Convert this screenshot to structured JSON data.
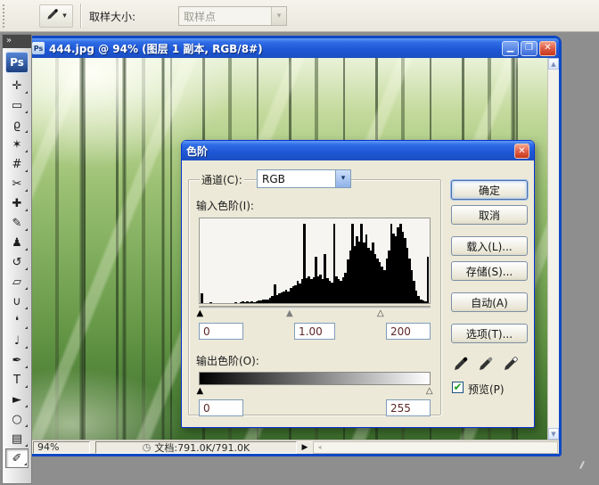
{
  "options_bar": {
    "dropdown_arrow_glyph": "▾",
    "sample_size_label": "取样大小:",
    "sample_point_value": "取样点"
  },
  "toolbox": {
    "collapse_glyph": "»",
    "logo_text": "Ps",
    "tools": [
      {
        "name": "move-tool",
        "glyph": "✛"
      },
      {
        "name": "marquee-tool",
        "glyph": "▭"
      },
      {
        "name": "lasso-tool",
        "glyph": "ϱ"
      },
      {
        "name": "magic-wand-tool",
        "glyph": "✶"
      },
      {
        "name": "crop-tool",
        "glyph": "#"
      },
      {
        "name": "slice-tool",
        "glyph": "✂"
      },
      {
        "name": "healing-brush-tool",
        "glyph": "✚"
      },
      {
        "name": "brush-tool",
        "glyph": "✎"
      },
      {
        "name": "clone-stamp-tool",
        "glyph": "♟"
      },
      {
        "name": "history-brush-tool",
        "glyph": "↺"
      },
      {
        "name": "eraser-tool",
        "glyph": "▱"
      },
      {
        "name": "paint-bucket-tool",
        "glyph": "∪"
      },
      {
        "name": "blur-tool",
        "glyph": "❛"
      },
      {
        "name": "dodge-tool",
        "glyph": "♩"
      },
      {
        "name": "pen-tool",
        "glyph": "✒"
      },
      {
        "name": "type-tool",
        "glyph": "T"
      },
      {
        "name": "path-select-tool",
        "glyph": "►"
      },
      {
        "name": "shape-tool",
        "glyph": "○"
      },
      {
        "name": "notes-tool",
        "glyph": "▤"
      },
      {
        "name": "eyedropper-tool",
        "glyph": "✐",
        "selected": true
      }
    ]
  },
  "document_window": {
    "icon_text": "Ps",
    "title": "444.jpg @ 94% (图层 1 副本, RGB/8#)",
    "minimize_glyph": "▁",
    "maximize_glyph": "❐",
    "close_glyph": "✕",
    "status": {
      "zoom_value": "94%",
      "clock_glyph": "◷",
      "doc_info": "文档:791.0K/791.0K",
      "popup_arrow_glyph": "▶",
      "hscroll_left_glyph": "◂",
      "vscroll_up_glyph": "▲",
      "vscroll_down_glyph": "▼"
    }
  },
  "levels_dialog": {
    "title": "色阶",
    "close_glyph": "✕",
    "channel_label": "通道(C):",
    "channel_value": "RGB",
    "channel_dropdown_glyph": "▾",
    "input_label": "输入色阶(I):",
    "input_black": "0",
    "input_gamma": "1.00",
    "input_white": "200",
    "output_label": "输出色阶(O):",
    "output_black": "0",
    "output_white": "255",
    "buttons": [
      {
        "name": "ok",
        "label": "确定",
        "default": true
      },
      {
        "name": "cancel",
        "label": "取消"
      },
      {
        "name": "load",
        "label": "载入(L)..."
      },
      {
        "name": "save",
        "label": "存储(S)..."
      },
      {
        "name": "auto",
        "label": "自动(A)"
      },
      {
        "name": "options",
        "label": "选项(T)..."
      }
    ],
    "preview_label": "预览(P)",
    "preview_checked": true,
    "preview_check_glyph": "✔",
    "histogram": {
      "type": "bar",
      "values": [
        12,
        0,
        0,
        0,
        1,
        0,
        0,
        0,
        0,
        0,
        0,
        0,
        0,
        0,
        0,
        1,
        0,
        1,
        2,
        1,
        2,
        1,
        2,
        1,
        2,
        3,
        3,
        4,
        5,
        5,
        7,
        9,
        24,
        10,
        12,
        13,
        15,
        17,
        15,
        19,
        21,
        23,
        28,
        25,
        30,
        100,
        31,
        34,
        30,
        33,
        58,
        34,
        36,
        30,
        62,
        32,
        28,
        26,
        100,
        34,
        30,
        28,
        33,
        38,
        55,
        66,
        100,
        72,
        84,
        78,
        100,
        76,
        86,
        70,
        66,
        76,
        62,
        56,
        52,
        46,
        42,
        56,
        66,
        100,
        88,
        84,
        96,
        100,
        90,
        82,
        70,
        56,
        42,
        28,
        16,
        9,
        5,
        3,
        2,
        58
      ],
      "markers": {
        "black_pct": 0.5,
        "gray_pct": 39.2,
        "white_pct": 78.4,
        "out_black_pct": 0.5,
        "out_white_pct": 99.5
      },
      "slider_glyphs": {
        "black": "▲",
        "gray": "▲",
        "white": "△"
      }
    }
  },
  "colors": {
    "titlebar_blue": "#2166E8",
    "window_border": "#0F48C4",
    "dialog_bg": "#ECE9D8",
    "desktop_gray": "#8E8E8E",
    "close_red": "#D8472F",
    "check_green": "#1E9E1E"
  }
}
